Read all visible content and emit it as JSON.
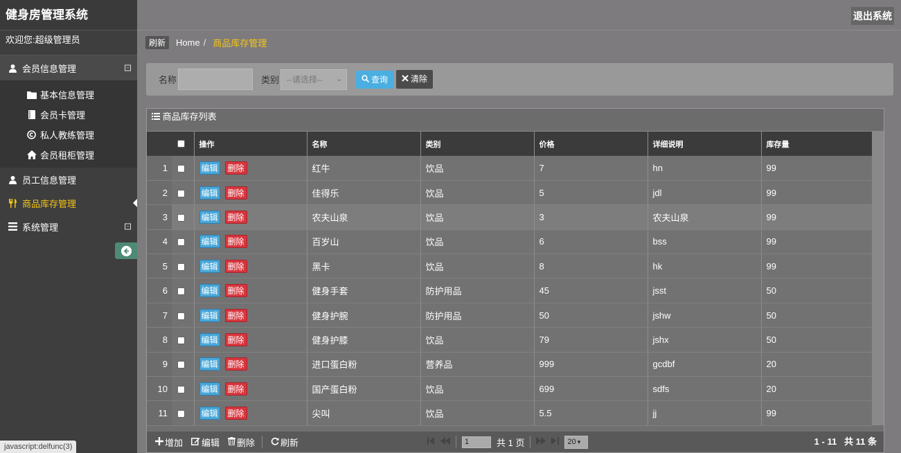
{
  "app": {
    "title": "健身房管理系统",
    "welcome": "欢迎您:超级管理员",
    "logout": "退出系统"
  },
  "sidebar": {
    "groups": [
      {
        "label": "会员信息管理",
        "icon": "user-icon",
        "toggle": "⊟",
        "items": [
          {
            "label": "基本信息管理",
            "icon": "folder-icon"
          },
          {
            "label": "会员卡管理",
            "icon": "book-icon"
          },
          {
            "label": "私人教练管理",
            "icon": "copyright-icon"
          },
          {
            "label": "会员租柜管理",
            "icon": "home-icon"
          }
        ]
      },
      {
        "label": "员工信息管理",
        "icon": "user-icon"
      },
      {
        "label": "商品库存管理",
        "icon": "cutlery-icon",
        "active": true
      },
      {
        "label": "系统管理",
        "icon": "list-icon",
        "toggle": "⊟"
      }
    ]
  },
  "statusbar": "javascript:delfunc(3)",
  "breadcrumb": {
    "refresh": "刷新",
    "home": "Home",
    "sep": "/",
    "current": "商品库存管理"
  },
  "search": {
    "name_label": "名称",
    "name_value": "",
    "category_label": "类别",
    "category_selected": "--请选择--",
    "query_label": "查询",
    "clear_label": "清除"
  },
  "panel": {
    "title": "商品库存列表"
  },
  "table": {
    "columns": [
      "操作",
      "名称",
      "类别",
      "价格",
      "详细说明",
      "库存量"
    ],
    "edit_label": "编辑",
    "delete_label": "删除",
    "rows": [
      {
        "n": "1",
        "name": "红牛",
        "cat": "饮品",
        "price": "7",
        "desc": "hn",
        "stock": "99"
      },
      {
        "n": "2",
        "name": "佳得乐",
        "cat": "饮品",
        "price": "5",
        "desc": "jdl",
        "stock": "99"
      },
      {
        "n": "3",
        "name": "农夫山泉",
        "cat": "饮品",
        "price": "3",
        "desc": "农夫山泉",
        "stock": "99"
      },
      {
        "n": "4",
        "name": "百岁山",
        "cat": "饮品",
        "price": "6",
        "desc": "bss",
        "stock": "99"
      },
      {
        "n": "5",
        "name": "黑卡",
        "cat": "饮品",
        "price": "8",
        "desc": "hk",
        "stock": "99"
      },
      {
        "n": "6",
        "name": "健身手套",
        "cat": "防护用品",
        "price": "45",
        "desc": "jsst",
        "stock": "50"
      },
      {
        "n": "7",
        "name": "健身护腕",
        "cat": "防护用品",
        "price": "50",
        "desc": "jshw",
        "stock": "50"
      },
      {
        "n": "8",
        "name": "健身护膝",
        "cat": "饮品",
        "price": "79",
        "desc": "jshx",
        "stock": "50"
      },
      {
        "n": "9",
        "name": "进口蛋白粉",
        "cat": "营养品",
        "price": "999",
        "desc": "gcdbf",
        "stock": "20"
      },
      {
        "n": "10",
        "name": "国产蛋白粉",
        "cat": "饮品",
        "price": "699",
        "desc": "sdfs",
        "stock": "20"
      },
      {
        "n": "11",
        "name": "尖叫",
        "cat": "饮品",
        "price": "5.5",
        "desc": "jj",
        "stock": "99"
      }
    ]
  },
  "toolbar": {
    "add": "增加",
    "edit": "编辑",
    "delete": "删除",
    "refresh": "刷新"
  },
  "pager": {
    "page_value": "1",
    "total_pages": "共 1 页",
    "page_size": "20",
    "range": "1 - 11",
    "total": "共 11 条"
  }
}
